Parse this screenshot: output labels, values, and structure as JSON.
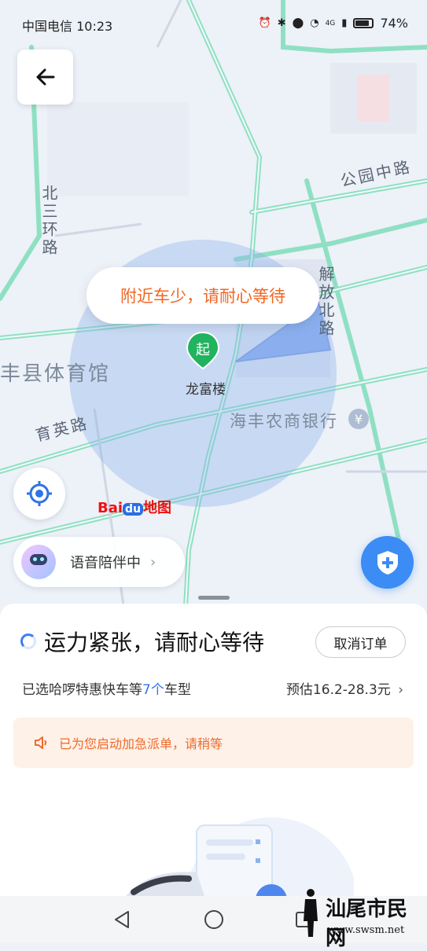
{
  "status_bar": {
    "carrier_time": "中国电信 10:23",
    "network": "4G",
    "battery": "74%",
    "icons": [
      "alarm-icon",
      "bluetooth-icon",
      "location-icon",
      "wifi-icon",
      "signal-icon",
      "battery-icon"
    ]
  },
  "map": {
    "wait_bubble": "附近车少，请耐心等待",
    "start_marker": "起",
    "pickup_poi": "龙富楼",
    "venue_label": "丰县体育馆",
    "bank_label": "海丰农商银行",
    "roads": {
      "north_ring": "北三环路",
      "gongyuan": "公园中路",
      "jiefang": "解放北路",
      "yuying": "育英路"
    },
    "baidu_logo_prefix": "Bai",
    "baidu_logo_du": "du",
    "baidu_logo_suffix": "地图",
    "voice_companion": "语音陪伴中"
  },
  "sheet": {
    "status_title": "运力紧张，请耐心等待",
    "cancel_button": "取消订单",
    "selected_prefix": "已选哈啰特惠快车等",
    "selected_count": "7个",
    "selected_suffix": "车型",
    "estimate": "预估16.2-28.3元",
    "notice": "已为您启动加急派单，请稍等"
  },
  "watermark": {
    "title": "汕尾市民网",
    "url": "www.swsm.net"
  },
  "colors": {
    "accent_orange": "#f06623",
    "primary_blue": "#2f73e8",
    "notice_bg": "#fdf1e8"
  }
}
